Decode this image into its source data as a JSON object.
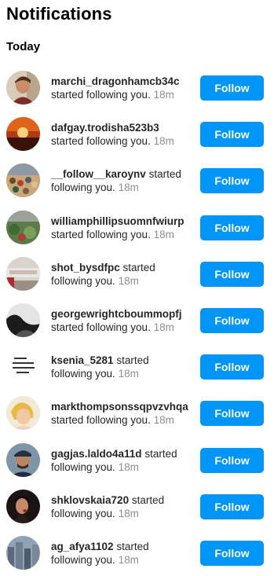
{
  "header": {
    "title": "Notifications"
  },
  "section": {
    "heading": "Today"
  },
  "notifications": [
    {
      "username": "marchi_dragonhamcb34c",
      "action": "started following you.",
      "time": "18m",
      "button": "Follow",
      "avatar_icon": "avatar-photo-man-portrait"
    },
    {
      "username": "dafgay.trodisha523b3",
      "action": "started following you.",
      "time": "18m",
      "button": "Follow",
      "avatar_icon": "avatar-photo-sunset"
    },
    {
      "username": "__follow__karoynv",
      "action": "started following you.",
      "time": "18m",
      "button": "Follow",
      "avatar_icon": "avatar-photo-crowd"
    },
    {
      "username": "williamphillipsuomnfwiurp",
      "action": "started following you.",
      "time": "18m",
      "button": "Follow",
      "avatar_icon": "avatar-photo-greenery"
    },
    {
      "username": "shot_bysdfpc",
      "action": "started following you.",
      "time": "18m",
      "button": "Follow",
      "avatar_icon": "avatar-photo-storefront"
    },
    {
      "username": "georgewrightcboummopfj",
      "action": "started following you.",
      "time": "18m",
      "button": "Follow",
      "avatar_icon": "avatar-photo-bw-landscape"
    },
    {
      "username": "ksenia_5281",
      "action": "started following you.",
      "time": "18m",
      "button": "Follow",
      "avatar_icon": "avatar-quote-text"
    },
    {
      "username": "markthompsonssqpvzvhqa",
      "action": "started following you.",
      "time": "18m",
      "button": "Follow",
      "avatar_icon": "avatar-photo-child"
    },
    {
      "username": "gagjas.laldo4a11d",
      "action": "started following you.",
      "time": "18m",
      "button": "Follow",
      "avatar_icon": "avatar-photo-man-cap"
    },
    {
      "username": "shklovskaia720",
      "action": "started following you.",
      "time": "18m",
      "button": "Follow",
      "avatar_icon": "avatar-photo-dark-portrait"
    },
    {
      "username": "ag_afya1102",
      "action": "started following you.",
      "time": "18m",
      "button": "Follow",
      "avatar_icon": "avatar-photo-city"
    }
  ],
  "colors": {
    "follow_button": "#0095f6",
    "follow_text": "#ffffff",
    "timestamp": "#8e8e8e"
  }
}
